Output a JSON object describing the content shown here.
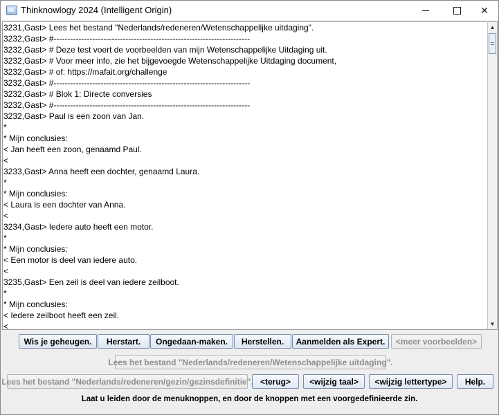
{
  "window": {
    "title": "Thinknowlogy 2024 (Intelligent Origin)"
  },
  "output_lines": [
    "3231,Gast> Lees het bestand \"Nederlands/redeneren/Wetenschappelijke uitdaging\".",
    "3232,Gast> #-----------------------------------------------------------------------",
    "3232,Gast> # Deze test voert de voorbeelden van mijn Wetenschappelijke Uitdaging uit.",
    "3232,Gast> # Voor meer info, zie het bijgevoegde Wetenschappelijke Uitdaging document,",
    "3232,Gast> # of: https://mafait.org/challenge",
    "3232,Gast> #-----------------------------------------------------------------------",
    "3232,Gast> # Blok 1: Directe conversies",
    "3232,Gast> #-----------------------------------------------------------------------",
    "3232,Gast> Paul is een zoon van Jan.",
    "*",
    "* Mijn conclusies:",
    "< Jan heeft een zoon, genaamd Paul.",
    "<",
    "3233,Gast> Anna heeft een dochter, genaamd Laura.",
    "*",
    "* Mijn conclusies:",
    "< Laura is een dochter van Anna.",
    "<",
    "3234,Gast> Iedere auto heeft een motor.",
    "*",
    "* Mijn conclusies:",
    "< Een motor is deel van iedere auto.",
    "<",
    "3235,Gast> Een zeil is deel van iedere zeilboot.",
    "*",
    "* Mijn conclusies:",
    "< Iedere zeilboot heeft een zeil.",
    "<"
  ],
  "buttons": {
    "row1": [
      {
        "label": "Wis je geheugen.",
        "enabled": true
      },
      {
        "label": "Herstart.",
        "enabled": true
      },
      {
        "label": "Ongedaan-maken.",
        "enabled": true
      },
      {
        "label": "Herstellen.",
        "enabled": true
      },
      {
        "label": "Aanmelden als Expert.",
        "enabled": true
      },
      {
        "label": "<meer voorbeelden>",
        "enabled": false
      }
    ],
    "row2": [
      {
        "label": "Lees het bestand \"Nederlands/redeneren/Wetenschappelijke uitdaging\".",
        "enabled": false
      }
    ],
    "row3": [
      {
        "label": "Lees het bestand \"Nederlands/redeneren/gezin/gezinsdefinitie\".",
        "enabled": false
      },
      {
        "label": "<terug>",
        "enabled": true
      },
      {
        "label": "<wijzig taal>",
        "enabled": true
      },
      {
        "label": "<wijzig lettertype>",
        "enabled": true
      },
      {
        "label": "Help.",
        "enabled": true
      }
    ]
  },
  "hint_text": "Laat u leiden door de menuknoppen, en door de knoppen met een voorgedefinieerde zin.",
  "icons": {
    "app": "app-icon",
    "minimize": "minimize-icon",
    "maximize": "maximize-icon",
    "close": "close-icon",
    "scroll_up": "scroll-up-arrow-icon",
    "scroll_down": "scroll-down-arrow-icon"
  }
}
